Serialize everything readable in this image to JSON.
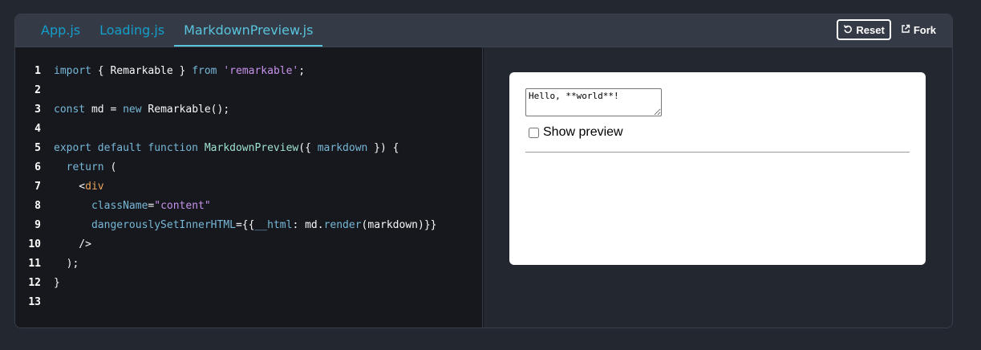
{
  "tabs": [
    {
      "label": "App.js",
      "active": false
    },
    {
      "label": "Loading.js",
      "active": false
    },
    {
      "label": "MarkdownPreview.js",
      "active": true
    }
  ],
  "actions": {
    "reset_label": "Reset",
    "fork_label": "Fork"
  },
  "code": {
    "line_numbers": [
      "1",
      "2",
      "3",
      "4",
      "5",
      "6",
      "7",
      "8",
      "9",
      "10",
      "11",
      "12",
      "13"
    ],
    "lines": [
      [
        {
          "t": "kw",
          "v": "import"
        },
        {
          "t": "txt",
          "v": " { Remarkable } "
        },
        {
          "t": "kw",
          "v": "from"
        },
        {
          "t": "txt",
          "v": " "
        },
        {
          "t": "str",
          "v": "'remarkable'"
        },
        {
          "t": "txt",
          "v": ";"
        }
      ],
      [],
      [
        {
          "t": "kw",
          "v": "const"
        },
        {
          "t": "txt",
          "v": " md = "
        },
        {
          "t": "kw",
          "v": "new"
        },
        {
          "t": "txt",
          "v": " Remarkable();"
        }
      ],
      [],
      [
        {
          "t": "kw",
          "v": "export default function"
        },
        {
          "t": "txt",
          "v": " "
        },
        {
          "t": "fn",
          "v": "MarkdownPreview"
        },
        {
          "t": "txt",
          "v": "({ "
        },
        {
          "t": "attr",
          "v": "markdown"
        },
        {
          "t": "txt",
          "v": " }) {"
        }
      ],
      [
        {
          "t": "txt",
          "v": "  "
        },
        {
          "t": "kw",
          "v": "return"
        },
        {
          "t": "txt",
          "v": " ("
        }
      ],
      [
        {
          "t": "txt",
          "v": "    <"
        },
        {
          "t": "tag",
          "v": "div"
        }
      ],
      [
        {
          "t": "txt",
          "v": "      "
        },
        {
          "t": "attr",
          "v": "className"
        },
        {
          "t": "txt",
          "v": "="
        },
        {
          "t": "str",
          "v": "\"content\""
        }
      ],
      [
        {
          "t": "txt",
          "v": "      "
        },
        {
          "t": "attr",
          "v": "dangerouslySetInnerHTML"
        },
        {
          "t": "txt",
          "v": "={{"
        },
        {
          "t": "attr",
          "v": "__html"
        },
        {
          "t": "txt",
          "v": ": md."
        },
        {
          "t": "attr",
          "v": "render"
        },
        {
          "t": "txt",
          "v": "(markdown)}}"
        }
      ],
      [
        {
          "t": "txt",
          "v": "    />"
        }
      ],
      [
        {
          "t": "txt",
          "v": "  );"
        }
      ],
      [
        {
          "t": "txt",
          "v": "}"
        }
      ],
      []
    ]
  },
  "preview": {
    "textarea_value": "Hello, **world**!",
    "checkbox_label": "Show preview",
    "checkbox_checked": false
  },
  "colors": {
    "background": "#23272f",
    "tab_active": "#58c4dc",
    "tab": "#149eca",
    "keyword": "#77b7d7",
    "string": "#c792ea"
  }
}
